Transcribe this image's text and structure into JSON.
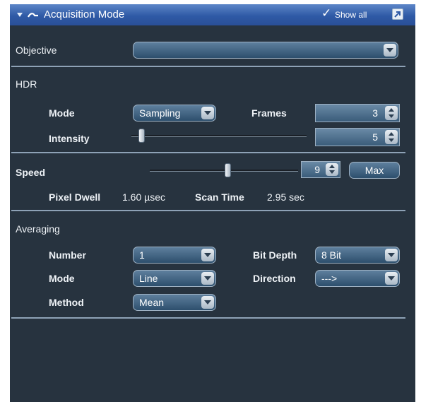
{
  "header": {
    "title": "Acquisition Mode",
    "show_all_label": "Show all"
  },
  "objective": {
    "label": "Objective",
    "value": ""
  },
  "hdr": {
    "section_label": "HDR",
    "mode_label": "Mode",
    "mode_value": "Sampling",
    "frames_label": "Frames",
    "frames_value": "3",
    "intensity_label": "Intensity",
    "intensity_value": "5"
  },
  "speed": {
    "label": "Speed",
    "value": "9",
    "max_label": "Max",
    "pixel_dwell_label": "Pixel Dwell",
    "pixel_dwell_value": "1.60 µsec",
    "scan_time_label": "Scan Time",
    "scan_time_value": "2.95 sec"
  },
  "averaging": {
    "section_label": "Averaging",
    "number_label": "Number",
    "number_value": "1",
    "mode_label": "Mode",
    "mode_value": "Line",
    "method_label": "Method",
    "method_value": "Mean",
    "bit_depth_label": "Bit Depth",
    "bit_depth_value": "8 Bit",
    "direction_label": "Direction",
    "direction_value": "--->"
  }
}
